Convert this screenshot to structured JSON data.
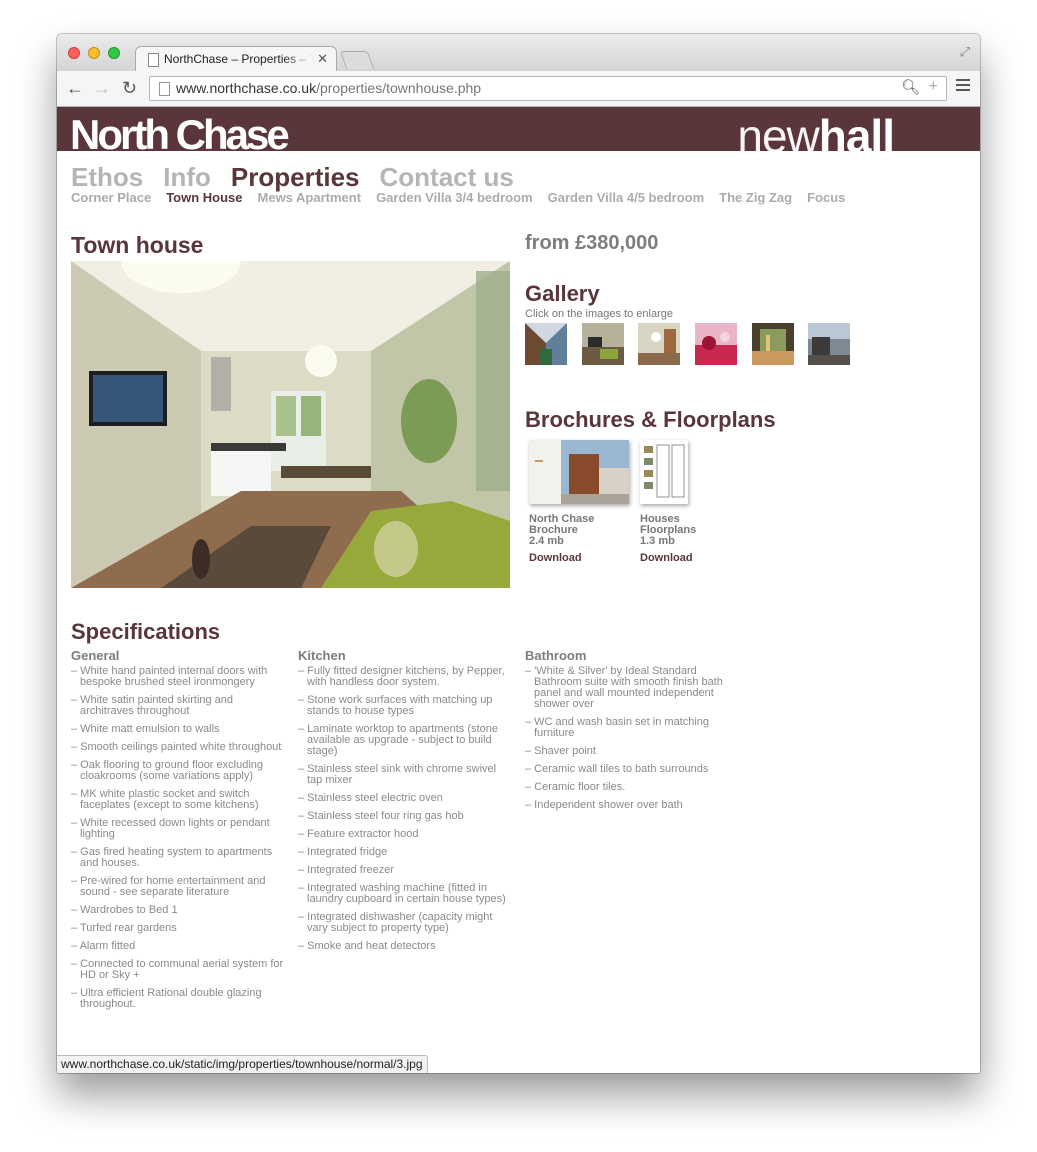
{
  "browser": {
    "tab_title": "NorthChase – Properties – Town House",
    "tab_close": "✕",
    "url_host": "www.northchase.co.uk",
    "url_path": "/properties/townhouse.php",
    "status_url": "www.northchase.co.uk/static/img/properties/townhouse/normal/3.jpg",
    "icons": [
      "back-icon",
      "forward-icon",
      "reload-icon",
      "page-icon",
      "zoom-icon",
      "bookmark-plus-icon",
      "menu-icon",
      "fullscreen-icon",
      "close-icon"
    ]
  },
  "site": {
    "logo": "North Chase",
    "brand_light": "new",
    "brand_bold": "hall",
    "brand_color": "#5a363b"
  },
  "nav": {
    "main": [
      "Ethos",
      "Info",
      "Properties",
      "Contact us"
    ],
    "main_active": "Properties",
    "sub": [
      "Corner Place",
      "Town House",
      "Mews Apartment",
      "Garden Villa 3/4 bedroom",
      "Garden Villa 4/5 bedroom",
      "The Zig Zag",
      "Focus"
    ],
    "sub_active": "Town House"
  },
  "property": {
    "title": "Town house",
    "price": "from £380,000"
  },
  "gallery": {
    "heading": "Gallery",
    "hint": "Click on the images to enlarge",
    "thumb_count": 6
  },
  "brochures": {
    "heading": "Brochures & Floorplans",
    "items": [
      {
        "title": "North Chase Brochure",
        "size": "2.4 mb",
        "link": "Download"
      },
      {
        "title": "Houses Floorplans",
        "size": "1.3 mb",
        "link": "Download"
      }
    ]
  },
  "specifications": {
    "heading": "Specifications",
    "columns": [
      {
        "title": "General",
        "items": [
          "– White hand painted internal doors with bespoke brushed steel ironmongery",
          "– White satin painted skirting and architraves throughout",
          "– White matt emulsion to walls",
          "– Smooth ceilings painted white throughout",
          "– Oak flooring to ground floor excluding cloakrooms (some variations apply)",
          "– MK white plastic socket and switch faceplates (except to some kitchens)",
          "– White recessed down lights or pendant lighting",
          "– Gas fired heating system to apartments and houses.",
          "– Pre-wired for home entertainment and sound - see separate literature",
          "– Wardrobes to Bed 1",
          "– Turfed rear gardens",
          "– Alarm fitted",
          "– Connected to communal aerial system for HD or Sky +",
          "– Ultra efficient Rational double glazing throughout."
        ]
      },
      {
        "title": "Kitchen",
        "items": [
          "– Fully fitted designer kitchens, by Pepper, with handless door system.",
          "– Stone work surfaces with matching up stands to house types",
          "– Laminate worktop to apartments (stone available as upgrade - subject to build stage)",
          "– Stainless steel sink with chrome swivel tap mixer",
          "– Stainless steel electric oven",
          "– Stainless steel four ring gas hob",
          "– Feature extractor hood",
          "– Integrated fridge",
          "– Integrated freezer",
          "– Integrated washing machine (fitted in laundry cupboard in certain house types)",
          "– Integrated dishwasher (capacity might vary subject to property type)",
          "– Smoke and heat detectors"
        ]
      },
      {
        "title": "Bathroom",
        "items": [
          "– 'White & Silver' by Ideal Standard Bathroom suite with smooth finish bath panel and wall mounted independent shower over",
          "– WC and wash basin set in matching furniture",
          "– Shaver point",
          "– Ceramic wall tiles to bath surrounds",
          "– Ceramic floor tiles.",
          "– Independent shower over bath"
        ]
      }
    ]
  }
}
